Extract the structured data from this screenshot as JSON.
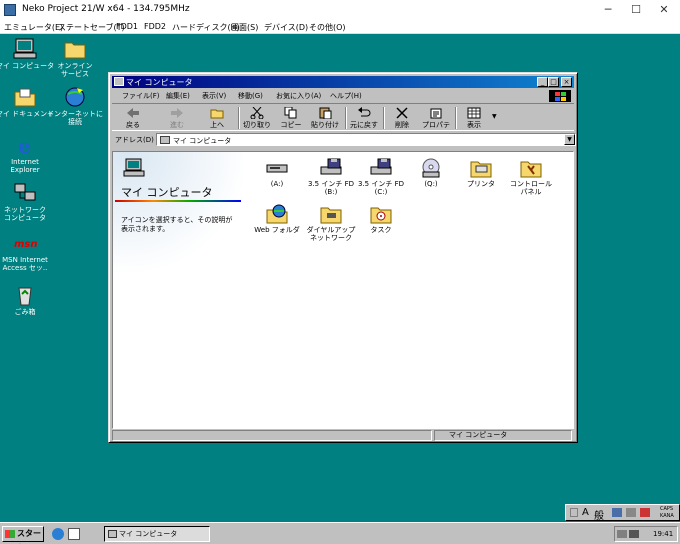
{
  "host": {
    "title": "Neko Project 21/W x64 - 134.795MHz",
    "menu": [
      "エミュレータ(E)",
      "ステートセーブ(T)",
      "FDD1",
      "FDD2",
      "ハードディスク(H)",
      "画面(S)",
      "デバイス(D)",
      "その他(O)"
    ]
  },
  "desktop": {
    "icons": [
      {
        "label": "マイ コンピュータ",
        "icon": "my-computer-icon"
      },
      {
        "label": "オンライン\nサービス",
        "icon": "folder-icon"
      },
      {
        "label": "マイ ドキュメント",
        "icon": "my-documents-icon"
      },
      {
        "label": "インターネットに\n接続",
        "icon": "connect-internet-icon"
      },
      {
        "label": "Internet\nExplorer",
        "icon": "internet-explorer-icon"
      },
      {
        "label": "ネットワーク\nコンピュータ",
        "icon": "network-icon"
      },
      {
        "label": "MSN Internet\nAccess セッ..",
        "icon": "msn-icon"
      },
      {
        "label": "ごみ箱",
        "icon": "recycle-bin-icon"
      }
    ]
  },
  "explorer": {
    "title": "マイ コンピュータ",
    "menu": [
      "ファイル(F)",
      "編集(E)",
      "表示(V)",
      "移動(G)",
      "お気に入り(A)",
      "ヘルプ(H)"
    ],
    "toolbar": [
      "戻る",
      "進む",
      "上へ",
      "切り取り",
      "コピー",
      "貼り付け",
      "元に戻す",
      "削除",
      "プロパティ",
      "表示"
    ],
    "address_label": "アドレス(D)",
    "address_value": "マイ コンピュータ",
    "left_title": "マイ コンピュータ",
    "left_desc": "アイコンを選択すると、その説明が\n表示されます。",
    "items": [
      {
        "label": "(A:)",
        "icon": "floppy-drive-icon"
      },
      {
        "label": "3.5 インチ FD\n(B:)",
        "icon": "floppy-drive-icon"
      },
      {
        "label": "3.5 インチ FD\n(C:)",
        "icon": "floppy-drive-icon"
      },
      {
        "label": "(Q:)",
        "icon": "cdrom-icon"
      },
      {
        "label": "プリンタ",
        "icon": "printers-folder-icon"
      },
      {
        "label": "コントロール\nパネル",
        "icon": "control-panel-icon"
      },
      {
        "label": "Web フォルダ",
        "icon": "web-folder-icon"
      },
      {
        "label": "ダイヤルアップ\nネットワーク",
        "icon": "dialup-networking-icon"
      },
      {
        "label": "タスク",
        "icon": "scheduled-tasks-icon"
      }
    ],
    "status_right": "マイ コンピュータ"
  },
  "taskbar": {
    "start_label": "スタート",
    "task_label": "マイ コンピュータ",
    "clock": "19:41",
    "ime": {
      "mode": "A",
      "conv": "般",
      "caps": "CAPS",
      "kana": "KANA"
    }
  },
  "colors": {
    "desktop": "#008080",
    "title_start": "#000080",
    "title_end": "#1084d0",
    "face": "#c0c0c0"
  }
}
